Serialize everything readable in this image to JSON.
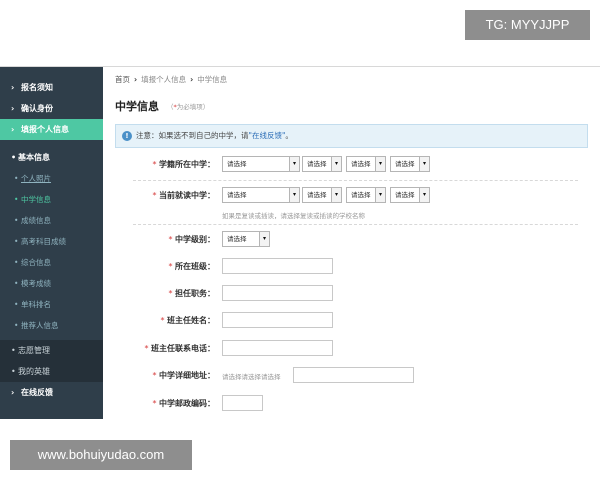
{
  "watermarks": {
    "tg": "TG: MYYJJPP",
    "url": "www.bohuiyudao.com"
  },
  "sidebar": {
    "items": [
      {
        "label": "报名须知",
        "icon": "chevron-right-icon"
      },
      {
        "label": "确认身份",
        "icon": "chevron-right-icon"
      },
      {
        "label": "填报个人信息",
        "icon": "chevron-right-icon"
      },
      {
        "label": "基本信息"
      },
      {
        "label": "个人照片"
      },
      {
        "label": "中学信息"
      },
      {
        "label": "成绩信息"
      },
      {
        "label": "高考科目成绩"
      },
      {
        "label": "综合信息"
      },
      {
        "label": "模考成绩"
      },
      {
        "label": "单科排名"
      },
      {
        "label": "推荐人信息"
      },
      {
        "label": "志愿管理"
      },
      {
        "label": "我的英雄"
      },
      {
        "label": "在线反馈",
        "icon": "chevron-right-icon"
      }
    ],
    "colors": {
      "bg": "#2f3e4a",
      "active": "#4ec8a3"
    }
  },
  "breadcrumb": {
    "home": "首页",
    "step": "填报个人信息",
    "current": "中学信息"
  },
  "page": {
    "title": "中学信息",
    "required_star": "*",
    "required_text": "为必填项"
  },
  "notice": {
    "icon": "info-icon",
    "text": "注意：如果选不到自己的中学，请",
    "link": "\"在线反馈\"",
    "tail": "。"
  },
  "form": {
    "select_placeholder": "请选择",
    "fields": {
      "school_location": {
        "label": "学籍所在中学："
      },
      "current_school": {
        "label": "当前就读中学：",
        "helper": "如果是复读或插读，请选择复读或插读的学校名称"
      },
      "school_level": {
        "label": "中学级别："
      },
      "class": {
        "label": "所在班级：",
        "value": ""
      },
      "position": {
        "label": "担任职务：",
        "value": ""
      },
      "teacher_name": {
        "label": "班主任姓名：",
        "value": ""
      },
      "teacher_phone": {
        "label": "班主任联系电话：",
        "value": ""
      },
      "address": {
        "label": "中学详细地址：",
        "value": "请选择请选择请选择"
      },
      "postcode": {
        "label": "中学邮政编码：",
        "value": ""
      }
    }
  }
}
